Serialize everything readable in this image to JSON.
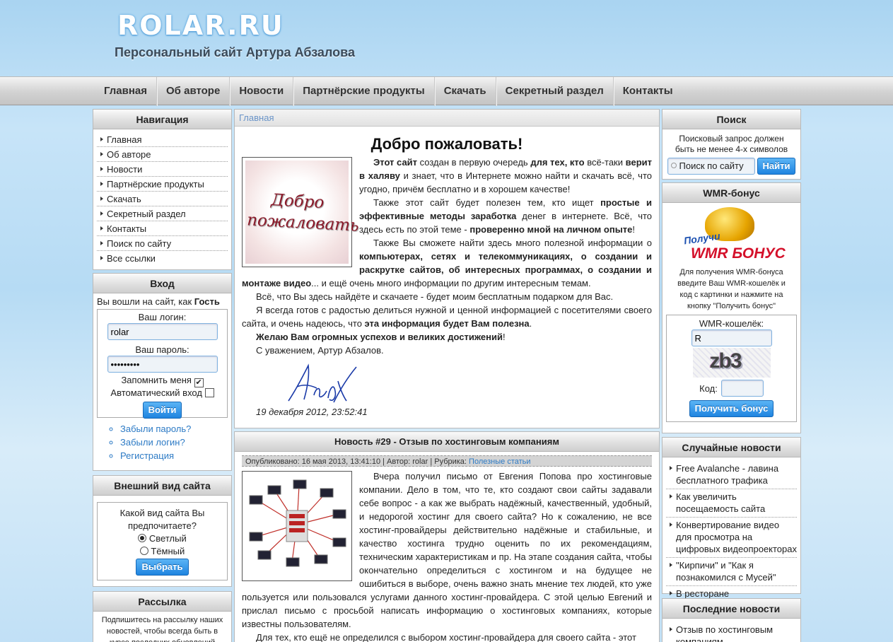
{
  "header": {
    "logo": "ROLAR.RU",
    "tagline": "Персональный сайт Артура Абзалова"
  },
  "topnav": [
    "Главная",
    "Об авторе",
    "Новости",
    "Партнёрские продукты",
    "Скачать",
    "Секретный раздел",
    "Контакты"
  ],
  "nav": {
    "title": "Навигация",
    "items": [
      "Главная",
      "Об авторе",
      "Новости",
      "Партнёрские продукты",
      "Скачать",
      "Секретный раздел",
      "Контакты",
      "Поиск по сайту",
      "Все ссылки"
    ]
  },
  "login": {
    "title": "Вход",
    "greeting_pre": "Вы вошли на сайт, как",
    "greeting_user": "Гость",
    "login_label": "Ваш логин:",
    "login_value": "rolar",
    "password_label": "Ваш пароль:",
    "password_value": "•••••••••",
    "remember_label": "Запомнить меня",
    "auto_label": "Автоматический вход",
    "submit": "Войти",
    "links": [
      "Забыли пароль?",
      "Забыли логин?",
      "Регистрация"
    ]
  },
  "appearance": {
    "title": "Внешний вид сайта",
    "question": "Какой вид сайта Вы предпочитаете?",
    "opt_light": "Светлый",
    "opt_dark": "Тёмный",
    "submit": "Выбрать"
  },
  "newsletter": {
    "title": "Рассылка",
    "text": "Подпишитесь на рассылку наших новостей, чтобы всегда быть в курсе последних обновлений"
  },
  "breadcrumb": "Главная",
  "welcome": {
    "title": "Добро пожаловать!",
    "image_text": "Добро пожаловать",
    "p1_a": "Этот сайт",
    "p1_b": " создан в первую очередь ",
    "p1_c": "для тех, кто",
    "p1_d": " всё-таки ",
    "p1_e": "верит в халяву",
    "p1_f": " и знает, что в Интернете можно найти и скачать всё, что угодно, причём бесплатно и в хорошем качестве!",
    "p2_a": "Также этот сайт будет полезен тем, кто ищет ",
    "p2_b": "простые и эффективные методы заработка",
    "p2_c": " денег в интернете. Всё, что здесь есть по этой теме - ",
    "p2_d": "проверенно мной на личном опыте",
    "p2_e": "!",
    "p3_a": "Также Вы сможете найти здесь много полезной информации о ",
    "p3_b": "компьютерах, сетях и телекоммуникациях, о создании и раскрутке сайтов, об интересных программах, о создании и монтаже видео",
    "p3_c": "... и ещё очень много информации по другим интересным темам.",
    "p4": "Всё, что Вы здесь найдёте и скачаете - будет моим бесплатным подарком для Вас.",
    "p5_a": "Я всегда готов с радостью делиться нужной и ценной информацией с посетителями своего сайта, и очень надеюсь, что ",
    "p5_b": "эта информация будет Вам полезна",
    "p5_c": ".",
    "p6": "Желаю Вам огромных успехов и великих достижений",
    "p6_end": "!",
    "p7": "С уважением, Артур Абзалов.",
    "date": "19 декабря 2012, 23:52:41"
  },
  "news": {
    "title": "Новость #29 - Отзыв по хостинговым компаниям",
    "meta": "Опубликовано: 16 мая 2013, 13:41:10 | Автор: rolar | Рубрика: ",
    "category": "Полезные статьи",
    "p1": "Вчера получил письмо от Евгения Попова про хостинговые компании. Дело в том, что те, кто создают свои сайты задавали себе вопрос - а как же выбрать надёжный, качественный, удобный, и недорогой хостинг для своего сайта? Но к сожалению, не все хостинг-провайдеры действительно надёжные и стабильные, и качество хостинга трудно оценить по их рекомендациям, техническим характеристикам и пр. На этапе создания сайта, чтобы окончательно определиться с хостингом и на будущее не ошибиться в выборе, очень важно знать мнение тех людей, кто уже пользуется или пользовался услугами данного хостинг-провайдера. С этой целью Евгений и прислал письмо с просьбой написать информацию о хостинговых компаниях, которые известны пользователям.",
    "p2": "Для тех, кто ещё не определился с выбором хостинг-провайдера для своего сайта - этот"
  },
  "search": {
    "title": "Поиск",
    "hint": "Поисковый запрос должен быть не менее 4-х символов",
    "placeholder": "Поиск по сайту",
    "submit": "Найти"
  },
  "wmr": {
    "title": "WMR-бонус",
    "logo_small": "Получи",
    "logo_big": "WMR БОНУС",
    "desc": "Для получения WMR-бонуса введите Ваш WMR-кошелёк и код с картинки и нажмите на кнопку \"Получить бонус\"",
    "wallet_label": "WMR-кошелёк:",
    "wallet_value": "R",
    "captcha": "zb3",
    "code_label": "Код:",
    "submit": "Получить бонус"
  },
  "random_news": {
    "title": "Случайные новости",
    "items": [
      "Free Avalanche - лавина бесплатного трафика",
      "Как увеличить посещаемость сайта",
      "Конвертирование видео для просмотра на цифровых видеопроекторах",
      "\"Кирпичи\" и \"Как я познакомился с Мусей\"",
      "В ресторане"
    ]
  },
  "latest_news": {
    "title": "Последние новости",
    "items": [
      "Отзыв по хостинговым компаниям"
    ]
  }
}
